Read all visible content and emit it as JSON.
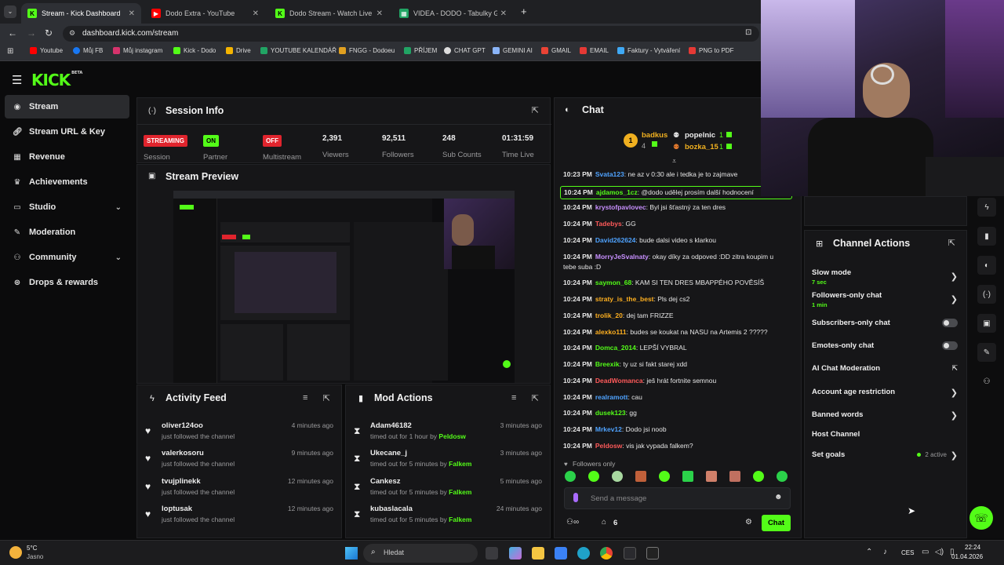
{
  "browser": {
    "tabs": [
      {
        "label": "Stream - Kick Dashboard",
        "icon": "kick-icon",
        "color": "#53fc18"
      },
      {
        "label": "Dodo Extra - YouTube",
        "icon": "youtube-icon",
        "color": "#ff0000"
      },
      {
        "label": "Dodo Stream - Watch Live on Ki",
        "icon": "kick-icon",
        "color": "#53fc18"
      },
      {
        "label": "VIDEA - DODO - Tabulky Googl",
        "icon": "sheets-icon",
        "color": "#21a464"
      }
    ],
    "new_tab": "+",
    "url": "dashboard.kick.com/stream",
    "bookmarks": [
      "Youtube",
      "Můj FB",
      "Můj instagram",
      "Kick - Dodo",
      "Drive",
      "YOUTUBE KALENDÁŘ",
      "FNGG - Dodoeu",
      "PŘÍJEM",
      "CHAT GPT",
      "GEMINI AI",
      "GMAIL",
      "EMAIL",
      "Faktury - Vytváření",
      "PNG to PDF"
    ]
  },
  "brand": {
    "logo": "KICK",
    "beta": "BETA",
    "accent": "#53fc18"
  },
  "sidebar": {
    "items": [
      {
        "label": "Stream",
        "icon": "stream-icon",
        "active": true
      },
      {
        "label": "Stream URL & Key",
        "icon": "link-icon"
      },
      {
        "label": "Revenue",
        "icon": "revenue-icon"
      },
      {
        "label": "Achievements",
        "icon": "trophy-icon"
      },
      {
        "label": "Studio",
        "icon": "studio-icon",
        "expandable": true
      },
      {
        "label": "Moderation",
        "icon": "wrench-icon"
      },
      {
        "label": "Community",
        "icon": "community-icon",
        "expandable": true
      },
      {
        "label": "Drops & rewards",
        "icon": "gift-icon"
      }
    ]
  },
  "session": {
    "title": "Session Info",
    "stats": [
      {
        "badge": "STREAMING",
        "label": "Session",
        "color": "#e0242d"
      },
      {
        "badge": "ON",
        "label": "Partner",
        "color": "#53fc18"
      },
      {
        "badge": "OFF",
        "label": "Multistream",
        "color": "#e0242d"
      },
      {
        "value": "2,391",
        "label": "Viewers"
      },
      {
        "value": "92,511",
        "label": "Followers"
      },
      {
        "value": "248",
        "label": "Sub Counts"
      },
      {
        "value": "01:31:59",
        "label": "Time Live"
      }
    ]
  },
  "preview": {
    "title": "Stream Preview"
  },
  "activity": {
    "title": "Activity Feed",
    "items": [
      {
        "name": "oliver124oo",
        "action": "just followed the channel",
        "time": "4 minutes ago"
      },
      {
        "name": "valerkosoru",
        "action": "just followed the channel",
        "time": "9 minutes ago"
      },
      {
        "name": "tvujplinekk",
        "action": "just followed the channel",
        "time": "12 minutes ago"
      },
      {
        "name": "loptusak",
        "action": "just followed the channel",
        "time": "12 minutes ago"
      }
    ]
  },
  "mod": {
    "title": "Mod Actions",
    "items": [
      {
        "name": "Adam46182",
        "action": "timed out for 1 hour by",
        "by": "Peldosw",
        "time": "3 minutes ago"
      },
      {
        "name": "Ukecane_j",
        "action": "timed out for 5 minutes by",
        "by": "Falkem",
        "time": "3 minutes ago"
      },
      {
        "name": "Cankesz",
        "action": "timed out for 5 minutes by",
        "by": "Falkem",
        "time": "5 minutes ago"
      },
      {
        "name": "kubaslacala",
        "action": "timed out for 5 minutes by",
        "by": "Falkem",
        "time": "24 minutes ago"
      }
    ]
  },
  "chat": {
    "title": "Chat",
    "leaderboard": [
      {
        "rank": "1",
        "name": "badkus",
        "count": "4"
      },
      {
        "name": "popelnic",
        "count": "1"
      },
      {
        "name": "bozka_15",
        "count": "1"
      }
    ],
    "messages": [
      {
        "time": "10:23 PM",
        "user": "Svata123",
        "color": "#4fa3ff",
        "text": "ne az v 0:30 ale i tedka je to zajmave"
      },
      {
        "time": "10:24 PM",
        "user": "ajdamos_1cz",
        "color": "#53fc18",
        "text": "@dodo udělej prosím další hodnocení",
        "highlight": true
      },
      {
        "time": "10:24 PM",
        "user": "krystofpavlovec",
        "color": "#c890ff",
        "text": "Byl jsi šťastný za ten dres"
      },
      {
        "time": "10:24 PM",
        "user": "Tadebys",
        "color": "#ff5a5a",
        "text": "GG"
      },
      {
        "time": "10:24 PM",
        "user": "David262624",
        "color": "#4fa3ff",
        "text": "bude dalsi video s klarkou"
      },
      {
        "time": "10:24 PM",
        "user": "MorryJeSvalnaty",
        "color": "#c890ff",
        "text": "okay díky za odpoved :DD zitra koupim u tebe suba :D"
      },
      {
        "time": "10:24 PM",
        "user": "saymon_68",
        "color": "#53fc18",
        "text": "KAM SI TEN DRES MBAPPÉHO POVĚSÍŠ"
      },
      {
        "time": "10:24 PM",
        "user": "straty_is_the_best",
        "color": "#ffb020",
        "text": "Pls dej cs2"
      },
      {
        "time": "10:24 PM",
        "user": "trolik_20",
        "color": "#ffb020",
        "text": "dej tam FRIZZE"
      },
      {
        "time": "10:24 PM",
        "user": "alexko111",
        "color": "#ffb020",
        "text": "budes se koukat na NASU na Artemis 2 ?????"
      },
      {
        "time": "10:24 PM",
        "user": "Domca_2014",
        "color": "#53fc18",
        "text": "LEPŠÍ VYBRAL"
      },
      {
        "time": "10:24 PM",
        "user": "Breexik",
        "color": "#53fc18",
        "text": "ty uz si fakt starej xdd"
      },
      {
        "time": "10:24 PM",
        "user": "DeadWomanca",
        "color": "#ff5a5a",
        "text": "ješ hrát fortnite semnou"
      },
      {
        "time": "10:24 PM",
        "user": "realramott",
        "color": "#4fa3ff",
        "text": "cau"
      },
      {
        "time": "10:24 PM",
        "user": "dusek123",
        "color": "#53fc18",
        "text": "gg"
      },
      {
        "time": "10:24 PM",
        "user": "Mrkev12",
        "color": "#4fa3ff",
        "text": "Dodo jsi noob"
      },
      {
        "time": "10:24 PM",
        "user": "Peldosw",
        "color": "#ff5a5a",
        "text": "vis jak vypada falkem?"
      }
    ],
    "followers_only": "Followers only",
    "placeholder": "Send a message",
    "viewers": "6",
    "send": "Chat"
  },
  "channel_actions": {
    "title": "Channel Actions",
    "items": [
      {
        "label": "Slow mode",
        "sub": "7 sec",
        "kind": "arrow"
      },
      {
        "label": "Followers-only chat",
        "sub": "1 min",
        "kind": "arrow"
      },
      {
        "label": "Subscribers-only chat",
        "kind": "toggle"
      },
      {
        "label": "Emotes-only chat",
        "kind": "toggle"
      },
      {
        "label": "AI Chat Moderation",
        "kind": "external"
      },
      {
        "label": "Account age restriction",
        "kind": "arrow"
      },
      {
        "label": "Banned words",
        "kind": "arrow"
      },
      {
        "label": "Host Channel",
        "kind": "none"
      },
      {
        "label": "Set goals",
        "status": "2 active",
        "kind": "arrow"
      }
    ]
  },
  "taskbar": {
    "weather": {
      "temp": "5°C",
      "cond": "Jasno"
    },
    "search": "Hledat",
    "lang": "CES",
    "time": "22:24",
    "date": "01.04.2026"
  }
}
